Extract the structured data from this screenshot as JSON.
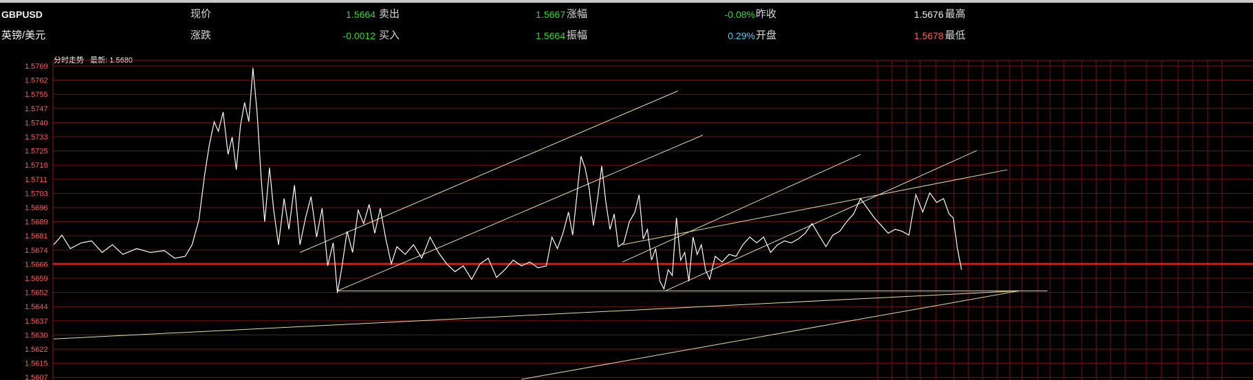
{
  "header": {
    "row1": {
      "symbol": "GBPUSD",
      "label1": "现价",
      "value1": "1.5664",
      "label2": "卖出",
      "value2": "1.5667",
      "label3": "涨幅",
      "value3": "-0.08%",
      "label4": "昨收",
      "value4": "1.5676",
      "label5": "最高"
    },
    "row2": {
      "symbol": "英镑/美元",
      "label1": "涨跌",
      "value1": "-0.0012",
      "label2": "买入",
      "value2": "1.5664",
      "label3": "振幅",
      "value3": "0.29%",
      "label4": "开盘",
      "value4": "1.5678",
      "label5": "最低"
    }
  },
  "chart_title": "分时走势",
  "chart_latest": "最新: 1.5680",
  "colors": {
    "price_line": "#ffffff",
    "reference_line": "#e01818",
    "grid": "#7a1010",
    "trend_lines": "#e8e0a0",
    "axis_labels": "#ff5a5a",
    "up": "#2fd82f",
    "flat": "#5ac8e8"
  },
  "chart_data": {
    "type": "line",
    "title": "",
    "xlabel": "",
    "ylabel": "",
    "y_ticks": [
      "1.5769",
      "1.5762",
      "1.5755",
      "1.5747",
      "1.5740",
      "1.5733",
      "1.5725",
      "1.5718",
      "1.5711",
      "1.5703",
      "1.5696",
      "1.5689",
      "1.5681",
      "1.5674",
      "1.5666",
      "1.5659",
      "1.5652",
      "1.5644",
      "1.5637",
      "1.5630",
      "1.5622",
      "1.5615",
      "1.5607"
    ],
    "ylim": [
      1.5607,
      1.5769
    ],
    "xlim": [
      0,
      1440
    ],
    "reference_price": 1.5666,
    "grid": true,
    "series": [
      {
        "values": [
          [
            0,
            1.5676
          ],
          [
            12,
            1.5681
          ],
          [
            24,
            1.5674
          ],
          [
            40,
            1.5677
          ],
          [
            55,
            1.5678
          ],
          [
            70,
            1.5672
          ],
          [
            85,
            1.5676
          ],
          [
            100,
            1.5671
          ],
          [
            120,
            1.5674
          ],
          [
            140,
            1.5672
          ],
          [
            160,
            1.5673
          ],
          [
            175,
            1.5669
          ],
          [
            190,
            1.567
          ],
          [
            200,
            1.5676
          ],
          [
            210,
            1.5689
          ],
          [
            218,
            1.5712
          ],
          [
            225,
            1.5728
          ],
          [
            232,
            1.574
          ],
          [
            238,
            1.5735
          ],
          [
            245,
            1.5745
          ],
          [
            252,
            1.5723
          ],
          [
            258,
            1.5732
          ],
          [
            264,
            1.5715
          ],
          [
            270,
            1.5738
          ],
          [
            276,
            1.575
          ],
          [
            282,
            1.574
          ],
          [
            288,
            1.5768
          ],
          [
            294,
            1.5745
          ],
          [
            300,
            1.571
          ],
          [
            305,
            1.5688
          ],
          [
            312,
            1.5716
          ],
          [
            318,
            1.5694
          ],
          [
            325,
            1.5676
          ],
          [
            333,
            1.57
          ],
          [
            340,
            1.5684
          ],
          [
            348,
            1.5707
          ],
          [
            356,
            1.5676
          ],
          [
            364,
            1.569
          ],
          [
            372,
            1.5701
          ],
          [
            380,
            1.568
          ],
          [
            388,
            1.5695
          ],
          [
            396,
            1.5665
          ],
          [
            404,
            1.5677
          ],
          [
            410,
            1.5651
          ],
          [
            416,
            1.5663
          ],
          [
            424,
            1.5683
          ],
          [
            432,
            1.5672
          ],
          [
            440,
            1.5694
          ],
          [
            448,
            1.5687
          ],
          [
            456,
            1.5697
          ],
          [
            464,
            1.5682
          ],
          [
            472,
            1.5695
          ],
          [
            480,
            1.5679
          ],
          [
            488,
            1.5666
          ],
          [
            496,
            1.5675
          ],
          [
            508,
            1.5671
          ],
          [
            520,
            1.5676
          ],
          [
            532,
            1.5669
          ],
          [
            544,
            1.568
          ],
          [
            556,
            1.5672
          ],
          [
            568,
            1.5666
          ],
          [
            580,
            1.5662
          ],
          [
            592,
            1.5665
          ],
          [
            604,
            1.5658
          ],
          [
            616,
            1.5666
          ],
          [
            628,
            1.5669
          ],
          [
            640,
            1.5659
          ],
          [
            652,
            1.5663
          ],
          [
            664,
            1.5668
          ],
          [
            676,
            1.5665
          ],
          [
            688,
            1.5667
          ],
          [
            700,
            1.5664
          ],
          [
            712,
            1.5665
          ],
          [
            720,
            1.568
          ],
          [
            728,
            1.5674
          ],
          [
            736,
            1.5682
          ],
          [
            744,
            1.5693
          ],
          [
            750,
            1.5681
          ],
          [
            756,
            1.5701
          ],
          [
            762,
            1.5722
          ],
          [
            768,
            1.5716
          ],
          [
            774,
            1.5705
          ],
          [
            780,
            1.5686
          ],
          [
            786,
            1.57
          ],
          [
            792,
            1.5717
          ],
          [
            798,
            1.5698
          ],
          [
            804,
            1.5684
          ],
          [
            810,
            1.5692
          ],
          [
            816,
            1.5675
          ],
          [
            824,
            1.5677
          ],
          [
            832,
            1.5688
          ],
          [
            840,
            1.5693
          ],
          [
            846,
            1.5702
          ],
          [
            852,
            1.5679
          ],
          [
            858,
            1.5684
          ],
          [
            864,
            1.5668
          ],
          [
            870,
            1.5674
          ],
          [
            876,
            1.5657
          ],
          [
            882,
            1.5653
          ],
          [
            888,
            1.5663
          ],
          [
            894,
            1.566
          ],
          [
            900,
            1.569
          ],
          [
            906,
            1.5668
          ],
          [
            912,
            1.5672
          ],
          [
            918,
            1.5657
          ],
          [
            924,
            1.568
          ],
          [
            930,
            1.5671
          ],
          [
            936,
            1.5676
          ],
          [
            942,
            1.5663
          ],
          [
            948,
            1.5658
          ],
          [
            956,
            1.567
          ],
          [
            966,
            1.5667
          ],
          [
            976,
            1.5671
          ],
          [
            986,
            1.567
          ],
          [
            996,
            1.5676
          ],
          [
            1006,
            1.568
          ],
          [
            1016,
            1.5677
          ],
          [
            1026,
            1.568
          ],
          [
            1036,
            1.5672
          ],
          [
            1046,
            1.5676
          ],
          [
            1056,
            1.5678
          ],
          [
            1066,
            1.5677
          ],
          [
            1076,
            1.5679
          ],
          [
            1086,
            1.5682
          ],
          [
            1096,
            1.5687
          ],
          [
            1106,
            1.5681
          ],
          [
            1116,
            1.5675
          ],
          [
            1126,
            1.5681
          ],
          [
            1136,
            1.5683
          ],
          [
            1146,
            1.5688
          ],
          [
            1156,
            1.5692
          ],
          [
            1166,
            1.57
          ],
          [
            1176,
            1.5695
          ],
          [
            1186,
            1.569
          ],
          [
            1196,
            1.5686
          ],
          [
            1206,
            1.5682
          ],
          [
            1216,
            1.5684
          ],
          [
            1226,
            1.5683
          ],
          [
            1236,
            1.5681
          ],
          [
            1246,
            1.5702
          ],
          [
            1256,
            1.5693
          ],
          [
            1266,
            1.5703
          ],
          [
            1276,
            1.5698
          ],
          [
            1286,
            1.57
          ],
          [
            1294,
            1.5692
          ],
          [
            1300,
            1.569
          ],
          [
            1306,
            1.5674
          ],
          [
            1312,
            1.5663
          ]
        ]
      }
    ]
  },
  "trend_lines": [
    {
      "from": [
        0,
        1.5627
      ],
      "to": [
        1395,
        1.5652
      ]
    },
    {
      "from": [
        410,
        1.5652
      ],
      "to": [
        1436,
        1.5652
      ]
    },
    {
      "from": [
        410,
        1.5652
      ],
      "to": [
        938,
        1.5733
      ]
    },
    {
      "from": [
        356,
        1.5672
      ],
      "to": [
        902,
        1.5756
      ]
    },
    {
      "from": [
        822,
        1.5667
      ],
      "to": [
        1166,
        1.5723
      ]
    },
    {
      "from": [
        884,
        1.5652
      ],
      "to": [
        1334,
        1.5725
      ]
    },
    {
      "from": [
        822,
        1.5676
      ],
      "to": [
        1378,
        1.5715
      ]
    },
    {
      "from": [
        676,
        1.5606
      ],
      "to": [
        1395,
        1.5652
      ]
    }
  ]
}
